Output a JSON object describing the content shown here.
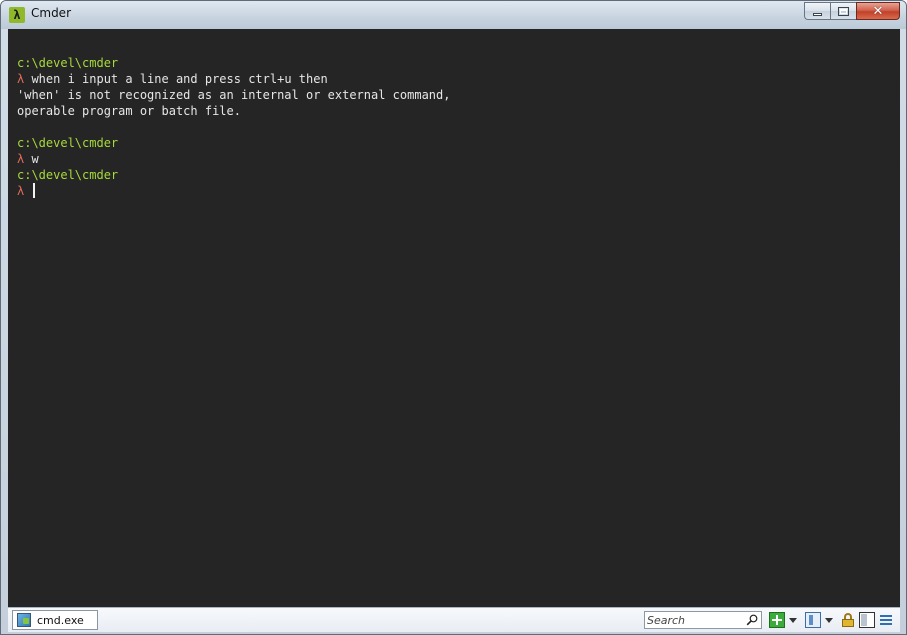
{
  "window": {
    "title": "Cmder",
    "app_icon_glyph": "λ",
    "buttons": {
      "minimize": "minimize-icon",
      "maximize": "maximize-icon",
      "close": "close-icon",
      "close_glyph": "✕"
    }
  },
  "terminal": {
    "lines": [
      {
        "type": "path",
        "text": "c:\\devel\\cmder"
      },
      {
        "type": "command",
        "prompt": "λ",
        "text": " when i input a line and press ctrl+u then"
      },
      {
        "type": "output",
        "text": "'when' is not recognized as an internal or external command,"
      },
      {
        "type": "output",
        "text": "operable program or batch file."
      },
      {
        "type": "blank",
        "text": ""
      },
      {
        "type": "path",
        "text": "c:\\devel\\cmder"
      },
      {
        "type": "command",
        "prompt": "λ",
        "text": " w"
      },
      {
        "type": "path",
        "text": "c:\\devel\\cmder"
      },
      {
        "type": "command",
        "prompt": "λ",
        "text": " "
      }
    ],
    "colors": {
      "background": "#252525",
      "path": "#a6d93a",
      "prompt": "#e06a58",
      "text": "#e6e6e6"
    }
  },
  "statusbar": {
    "tab_label": "cmd.exe",
    "search_placeholder": "Search",
    "icons": [
      "plus-icon",
      "split-icon",
      "lock-icon",
      "window-icon",
      "menu-icon"
    ]
  }
}
